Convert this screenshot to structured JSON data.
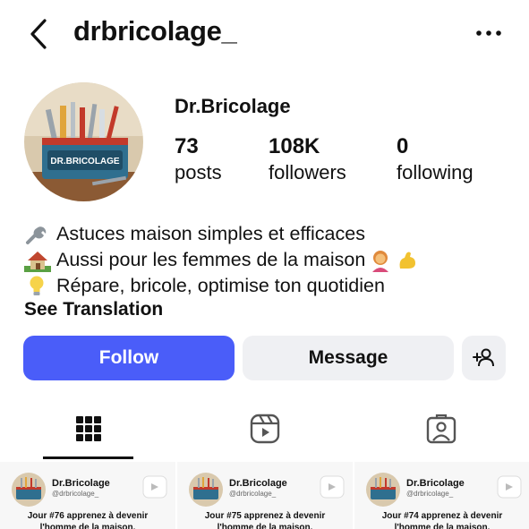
{
  "header": {
    "username": "drbricolage_",
    "back_icon": "chevron-left-icon",
    "more_icon": "more-horizontal-icon"
  },
  "profile": {
    "display_name": "Dr.Bricolage",
    "avatar_label": "DR.BRICOLAGE",
    "stats": {
      "posts": {
        "value": "73",
        "label": "posts"
      },
      "followers": {
        "value": "108K",
        "label": "followers"
      },
      "following": {
        "value": "0",
        "label": "following"
      }
    },
    "bio": [
      {
        "icon": "wrench-icon",
        "text": "Astuces maison simples et efficaces"
      },
      {
        "icon": "house-icon",
        "text": "Aussi pour les femmes de la maison",
        "trailing_icons": [
          "woman-icon",
          "flexed-biceps-icon"
        ]
      },
      {
        "icon": "light-bulb-icon",
        "text": "Répare, bricole, optimise ton quotidien"
      }
    ],
    "see_translation": "See Translation"
  },
  "actions": {
    "follow": "Follow",
    "message": "Message",
    "add_user_icon": "add-person-icon"
  },
  "tabs": [
    {
      "icon": "grid-icon",
      "selected": true
    },
    {
      "icon": "reels-icon",
      "selected": false
    },
    {
      "icon": "tagged-icon",
      "selected": false
    }
  ],
  "posts": [
    {
      "name": "Dr.Bricolage",
      "handle": "@drbricolage_",
      "caption_1": "Jour #76 apprenez à devenir",
      "caption_2": "l'homme de la maison."
    },
    {
      "name": "Dr.Bricolage",
      "handle": "@drbricolage_",
      "caption_1": "Jour #75 apprenez à devenir",
      "caption_2": "l'homme de la maison."
    },
    {
      "name": "Dr.Bricolage",
      "handle": "@drbricolage_",
      "caption_1": "Jour #74 apprenez à devenir",
      "caption_2": "l'homme de la maison."
    }
  ],
  "colors": {
    "follow_button": "#4a5df9",
    "secondary_button": "#eff0f3",
    "text": "#111111"
  }
}
